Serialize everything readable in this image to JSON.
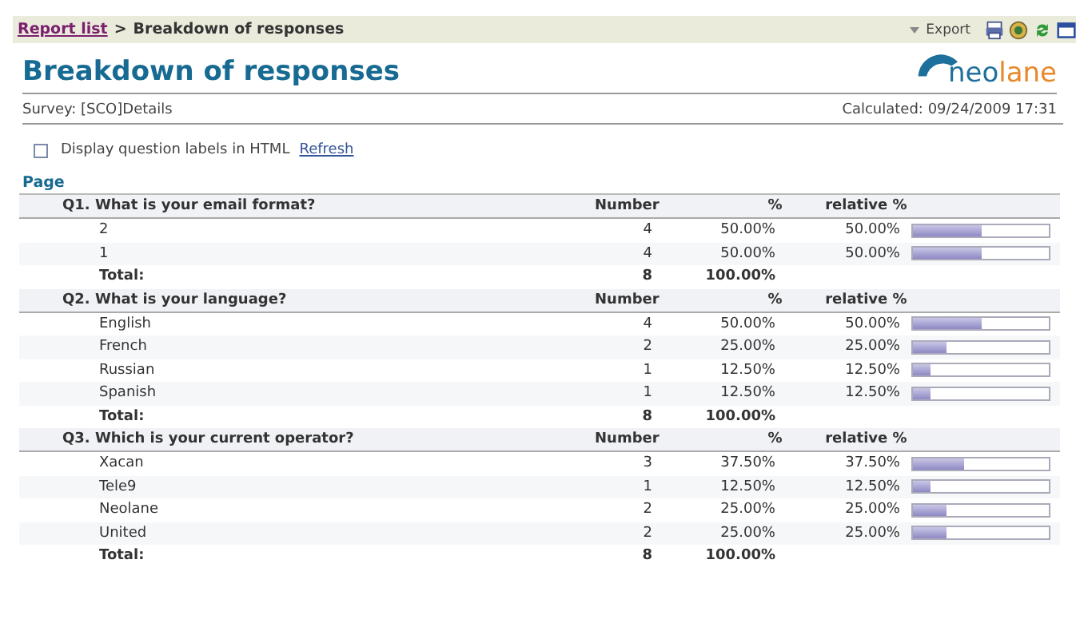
{
  "breadcrumb": {
    "link": "Report list",
    "separator": ">",
    "current": "Breakdown of responses"
  },
  "toolbar": {
    "export": "Export"
  },
  "title": "Breakdown of responses",
  "logo": {
    "parts": [
      "neo",
      "lane"
    ]
  },
  "survey": "Survey: [SCO]Details",
  "calculated": "Calculated: 09/24/2009 17:31",
  "options": {
    "label": "Display question labels in HTML",
    "checked": false,
    "refresh": "Refresh"
  },
  "section": "Page",
  "questions": [
    {
      "title": "Q1. What is your email format?",
      "columns": [
        "Number",
        "%",
        "relative %"
      ],
      "rows": [
        {
          "answer": "2",
          "number": "4",
          "percent": "50.00%",
          "relative": "50.00%",
          "level": 0.5
        },
        {
          "answer": "1",
          "number": "4",
          "percent": "50.00%",
          "relative": "50.00%",
          "level": 0.5
        }
      ],
      "total": {
        "label": "Total:",
        "number": "8",
        "percent": "100.00%"
      }
    },
    {
      "title": "Q2. What is your language?",
      "columns": [
        "Number",
        "%",
        "relative %"
      ],
      "rows": [
        {
          "answer": "English",
          "number": "4",
          "percent": "50.00%",
          "relative": "50.00%",
          "level": 0.5
        },
        {
          "answer": "French",
          "number": "2",
          "percent": "25.00%",
          "relative": "25.00%",
          "level": 0.25
        },
        {
          "answer": "Russian",
          "number": "1",
          "percent": "12.50%",
          "relative": "12.50%",
          "level": 0.125
        },
        {
          "answer": "Spanish",
          "number": "1",
          "percent": "12.50%",
          "relative": "12.50%",
          "level": 0.125
        }
      ],
      "total": {
        "label": "Total:",
        "number": "8",
        "percent": "100.00%"
      }
    },
    {
      "title": "Q3. Which is your current operator?",
      "columns": [
        "Number",
        "%",
        "relative %"
      ],
      "rows": [
        {
          "answer": "Xacan",
          "number": "3",
          "percent": "37.50%",
          "relative": "37.50%",
          "level": 0.375
        },
        {
          "answer": "Tele9",
          "number": "1",
          "percent": "12.50%",
          "relative": "12.50%",
          "level": 0.125
        },
        {
          "answer": "Neolane",
          "number": "2",
          "percent": "25.00%",
          "relative": "25.00%",
          "level": 0.25
        },
        {
          "answer": "United",
          "number": "2",
          "percent": "25.00%",
          "relative": "25.00%",
          "level": 0.25
        }
      ],
      "total": {
        "label": "Total:",
        "number": "8",
        "percent": "100.00%"
      }
    }
  ]
}
